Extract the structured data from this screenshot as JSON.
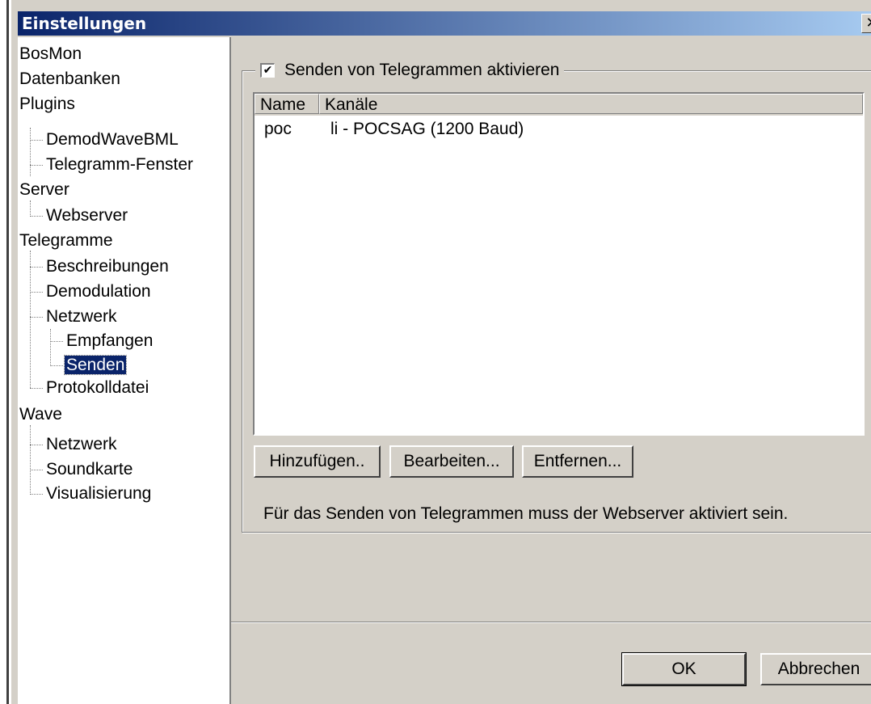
{
  "window": {
    "title": "Einstellungen",
    "close_glyph": "✕"
  },
  "tree": {
    "items": [
      {
        "label": "BosMon",
        "level": 0
      },
      {
        "label": "Datenbanken",
        "level": 0
      },
      {
        "label": "Plugins",
        "level": 0
      },
      {
        "label": "DemodWaveBML",
        "level": 1
      },
      {
        "label": "Telegramm-Fenster",
        "level": 1
      },
      {
        "label": "Server",
        "level": 0
      },
      {
        "label": "Webserver",
        "level": 1
      },
      {
        "label": "Telegramme",
        "level": 0
      },
      {
        "label": "Beschreibungen",
        "level": 1
      },
      {
        "label": "Demodulation",
        "level": 1
      },
      {
        "label": "Netzwerk",
        "level": 1
      },
      {
        "label": "Empfangen",
        "level": 2
      },
      {
        "label": "Senden",
        "level": 2,
        "selected": true
      },
      {
        "label": "Protokolldatei",
        "level": 1
      },
      {
        "label": "Wave",
        "level": 0
      },
      {
        "label": "Netzwerk",
        "level": 1
      },
      {
        "label": "Soundkarte",
        "level": 1
      },
      {
        "label": "Visualisierung",
        "level": 1
      }
    ]
  },
  "send_group": {
    "enable_label": "Senden von Telegrammen aktivieren",
    "enabled": true,
    "check_glyph": "✔"
  },
  "list": {
    "columns": [
      "Name",
      "Kanäle"
    ],
    "rows": [
      [
        "poc",
        "li - POCSAG (1200 Baud)"
      ]
    ]
  },
  "buttons": {
    "add": "Hinzufügen..",
    "edit": "Bearbeiten...",
    "remove": "Entfernen...",
    "ok": "OK",
    "cancel": "Abbrechen"
  },
  "info_text": "Für das Senden von Telegrammen muss der Webserver aktiviert sein."
}
